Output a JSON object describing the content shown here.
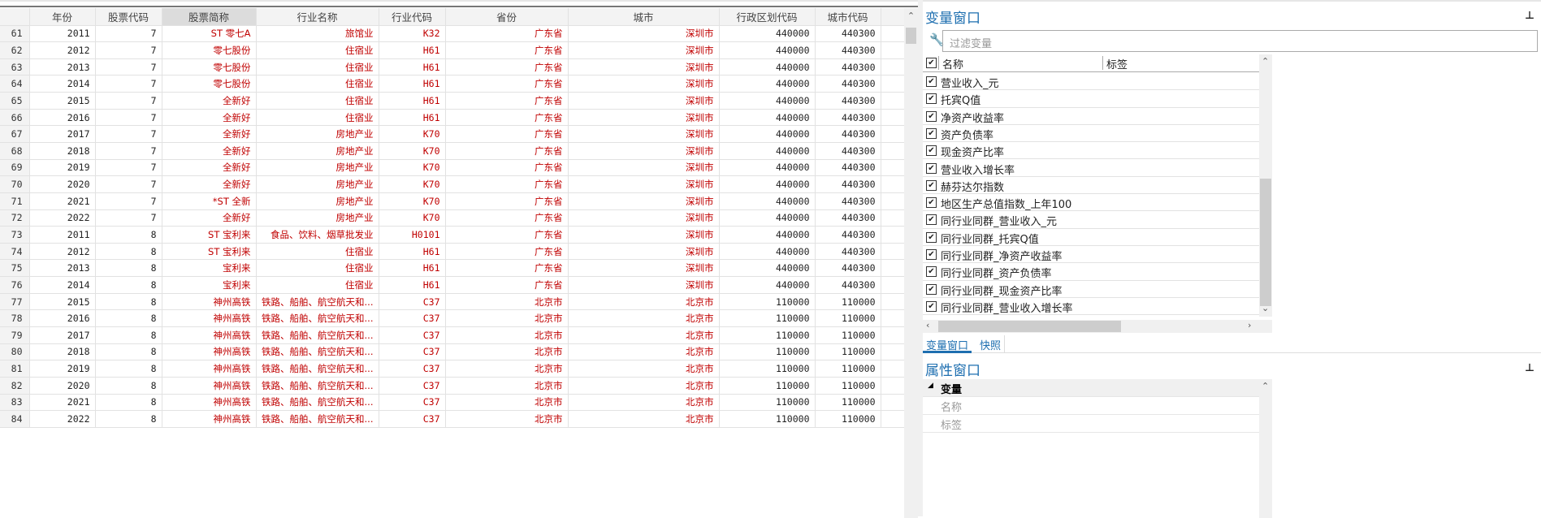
{
  "grid": {
    "columns": [
      "",
      "年份",
      "股票代码",
      "股票简称",
      "行业名称",
      "行业代码",
      "省份",
      "城市",
      "行政区划代码",
      "城市代码",
      ""
    ],
    "selected_column": "股票简称",
    "rows": [
      [
        "61",
        "2011",
        "7",
        "ST 零七A",
        "旅馆业",
        "K32",
        "广东省",
        "深圳市",
        "440000",
        "440300"
      ],
      [
        "62",
        "2012",
        "7",
        "零七股份",
        "住宿业",
        "H61",
        "广东省",
        "深圳市",
        "440000",
        "440300"
      ],
      [
        "63",
        "2013",
        "7",
        "零七股份",
        "住宿业",
        "H61",
        "广东省",
        "深圳市",
        "440000",
        "440300"
      ],
      [
        "64",
        "2014",
        "7",
        "零七股份",
        "住宿业",
        "H61",
        "广东省",
        "深圳市",
        "440000",
        "440300"
      ],
      [
        "65",
        "2015",
        "7",
        "全新好",
        "住宿业",
        "H61",
        "广东省",
        "深圳市",
        "440000",
        "440300"
      ],
      [
        "66",
        "2016",
        "7",
        "全新好",
        "住宿业",
        "H61",
        "广东省",
        "深圳市",
        "440000",
        "440300"
      ],
      [
        "67",
        "2017",
        "7",
        "全新好",
        "房地产业",
        "K70",
        "广东省",
        "深圳市",
        "440000",
        "440300"
      ],
      [
        "68",
        "2018",
        "7",
        "全新好",
        "房地产业",
        "K70",
        "广东省",
        "深圳市",
        "440000",
        "440300"
      ],
      [
        "69",
        "2019",
        "7",
        "全新好",
        "房地产业",
        "K70",
        "广东省",
        "深圳市",
        "440000",
        "440300"
      ],
      [
        "70",
        "2020",
        "7",
        "全新好",
        "房地产业",
        "K70",
        "广东省",
        "深圳市",
        "440000",
        "440300"
      ],
      [
        "71",
        "2021",
        "7",
        "*ST 全新",
        "房地产业",
        "K70",
        "广东省",
        "深圳市",
        "440000",
        "440300"
      ],
      [
        "72",
        "2022",
        "7",
        "全新好",
        "房地产业",
        "K70",
        "广东省",
        "深圳市",
        "440000",
        "440300"
      ],
      [
        "73",
        "2011",
        "8",
        "ST 宝利来",
        "食品、饮料、烟草批发业",
        "H0101",
        "广东省",
        "深圳市",
        "440000",
        "440300"
      ],
      [
        "74",
        "2012",
        "8",
        "ST 宝利来",
        "住宿业",
        "H61",
        "广东省",
        "深圳市",
        "440000",
        "440300"
      ],
      [
        "75",
        "2013",
        "8",
        "宝利来",
        "住宿业",
        "H61",
        "广东省",
        "深圳市",
        "440000",
        "440300"
      ],
      [
        "76",
        "2014",
        "8",
        "宝利来",
        "住宿业",
        "H61",
        "广东省",
        "深圳市",
        "440000",
        "440300"
      ],
      [
        "77",
        "2015",
        "8",
        "神州高铁",
        "铁路、船舶、航空航天和...",
        "C37",
        "北京市",
        "北京市",
        "110000",
        "110000"
      ],
      [
        "78",
        "2016",
        "8",
        "神州高铁",
        "铁路、船舶、航空航天和...",
        "C37",
        "北京市",
        "北京市",
        "110000",
        "110000"
      ],
      [
        "79",
        "2017",
        "8",
        "神州高铁",
        "铁路、船舶、航空航天和...",
        "C37",
        "北京市",
        "北京市",
        "110000",
        "110000"
      ],
      [
        "80",
        "2018",
        "8",
        "神州高铁",
        "铁路、船舶、航空航天和...",
        "C37",
        "北京市",
        "北京市",
        "110000",
        "110000"
      ],
      [
        "81",
        "2019",
        "8",
        "神州高铁",
        "铁路、船舶、航空航天和...",
        "C37",
        "北京市",
        "北京市",
        "110000",
        "110000"
      ],
      [
        "82",
        "2020",
        "8",
        "神州高铁",
        "铁路、船舶、航空航天和...",
        "C37",
        "北京市",
        "北京市",
        "110000",
        "110000"
      ],
      [
        "83",
        "2021",
        "8",
        "神州高铁",
        "铁路、船舶、航空航天和...",
        "C37",
        "北京市",
        "北京市",
        "110000",
        "110000"
      ],
      [
        "84",
        "2022",
        "8",
        "神州高铁",
        "铁路、船舶、航空航天和...",
        "C37",
        "北京市",
        "北京市",
        "110000",
        "110000"
      ]
    ]
  },
  "variable_window": {
    "title": "变量窗口",
    "filter_placeholder": "过滤变量",
    "col_name": "名称",
    "col_label": "标签",
    "items": [
      "营业收入_元",
      "托宾Q值",
      "净资产收益率",
      "资产负债率",
      "现金资产比率",
      "营业收入增长率",
      "赫芬达尔指数",
      "地区生产总值指数_上年100",
      "同行业同群_营业收入_元",
      "同行业同群_托宾Q值",
      "同行业同群_净资产收益率",
      "同行业同群_资产负债率",
      "同行业同群_现金资产比率",
      "同行业同群_营业收入增长率"
    ]
  },
  "tabs": [
    "变量窗口",
    "快照"
  ],
  "property_window": {
    "title": "属性窗口",
    "section": "变量",
    "rows": [
      "名称",
      "标签"
    ]
  },
  "colors": {
    "accent": "#1e6fb0",
    "data_text": "#c00000"
  }
}
